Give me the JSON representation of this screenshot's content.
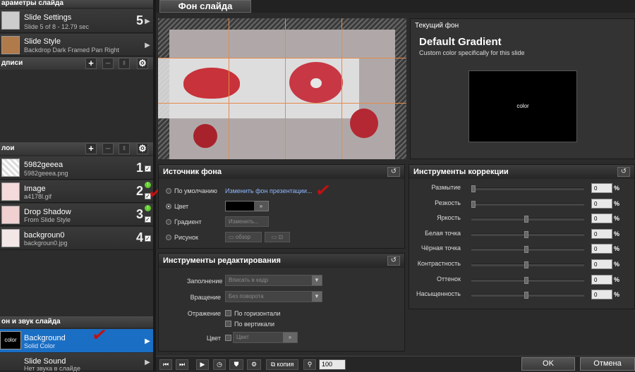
{
  "sidebar": {
    "slide_params_header": "араметры слайда",
    "slide_settings": {
      "title": "Slide Settings",
      "subtitle": "Slide 5 of 8 - 12.79 sec",
      "number": "5"
    },
    "slide_style": {
      "title": "Slide Style",
      "subtitle": "Backdrop Dark Framed Pan Right"
    },
    "captions_header": "дписи",
    "layers_header": "лои",
    "layers": [
      {
        "title": "5982geeea",
        "subtitle": "5982geeea.png",
        "number": "1"
      },
      {
        "title": "Image",
        "subtitle": "a4178l.gif",
        "number": "2"
      },
      {
        "title": "Drop Shadow",
        "subtitle": "From Slide Style",
        "number": "3"
      },
      {
        "title": "backgroun0",
        "subtitle": "backgroun0.jpg",
        "number": "4"
      }
    ],
    "bg_sound_header": "он и звук слайда",
    "background_item": {
      "title": "Background",
      "subtitle": "Solid Color",
      "thumb": "color"
    },
    "sound_item": {
      "title": "Slide Sound",
      "subtitle": "Нет звука в слайде"
    }
  },
  "tab_title": "Фон слайда",
  "current_bg": {
    "header": "Текущий фон",
    "title": "Default Gradient",
    "subtitle": "Custom color specifically for this slide",
    "preview_label": "color"
  },
  "bg_source": {
    "header": "Источник фона",
    "default_label": "По умолчанию",
    "change_link": "Изменить фон презентации...",
    "color_label": "Цвет",
    "gradient_label": "Градиент",
    "gradient_btn": "Изменить...",
    "image_label": "Рисунок",
    "browse_btn": "обзор"
  },
  "edit_tools": {
    "header": "Инструменты редактирования",
    "fill_label": "Заполнение",
    "fill_value": "Вписать в кадр",
    "rotation_label": "Вращение",
    "rotation_value": "Без поворота",
    "reflection_label": "Отражение",
    "horiz_label": "По горизонтали",
    "vert_label": "По вертикали",
    "color_label": "Цвет",
    "color_check_label": "Цвет"
  },
  "correction": {
    "header": "Инструменты коррекции",
    "items": [
      {
        "label": "Размытие",
        "value": "0",
        "unit": "%",
        "knob": 0
      },
      {
        "label": "Резкость",
        "value": "0",
        "unit": "%",
        "knob": 0
      },
      {
        "label": "Яркость",
        "value": "0",
        "unit": "%",
        "knob": 0.5
      },
      {
        "label": "Белая точка",
        "value": "0",
        "unit": "%",
        "knob": 0.5
      },
      {
        "label": "Чёрная точка",
        "value": "0",
        "unit": "%",
        "knob": 0.5
      },
      {
        "label": "Контрастность",
        "value": "0",
        "unit": "%",
        "knob": 0.5
      },
      {
        "label": "Оттенок",
        "value": "0",
        "unit": "%",
        "knob": 0.5
      },
      {
        "label": "Насыщенность",
        "value": "0",
        "unit": "%",
        "knob": 0.5
      }
    ]
  },
  "toolbar": {
    "copy_label": "копия",
    "zoom_value": "100"
  },
  "ok_label": "OK",
  "cancel_label": "Отмена",
  "colors": {
    "selected_blue": "#1a6fc4",
    "annotation_red": "#c41010",
    "link_blue": "#8fb8ff"
  }
}
